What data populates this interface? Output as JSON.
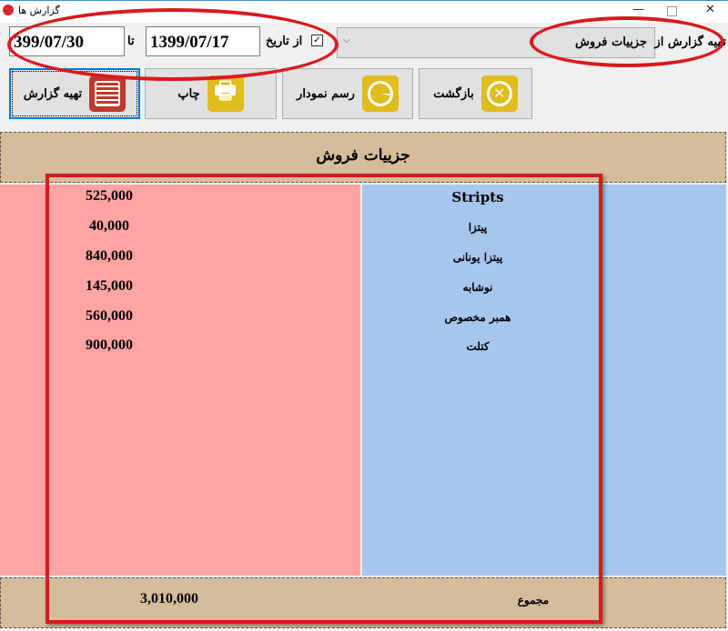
{
  "window": {
    "title": "گزارش ها",
    "controls": [
      "minimize",
      "maximize",
      "close"
    ]
  },
  "filter": {
    "to_date": "399/07/30",
    "to_label": "تا",
    "from_date": "1399/07/17",
    "from_label": "از تاریخ",
    "from_checked": true,
    "report_type_label": "تهیه گزارش از",
    "report_type_value": "جزییات فروش"
  },
  "toolbar": {
    "generate": "تهیه گزارش",
    "print": "چاپ",
    "chart": "رسم نمودار",
    "back": "بازگشت"
  },
  "report": {
    "title": "جزییات فروش",
    "rows": [
      {
        "name": "Stripts",
        "amount": "525,000"
      },
      {
        "name": "پیتزا",
        "amount": "40,000"
      },
      {
        "name": "پیتزا یونانی",
        "amount": "840,000"
      },
      {
        "name": "نوشابه",
        "amount": "145,000"
      },
      {
        "name": "همبر مخصوص",
        "amount": "560,000"
      },
      {
        "name": "کتلت",
        "amount": "900,000"
      }
    ],
    "total_label": "مجموع",
    "total": "3,010,000"
  },
  "colors": {
    "amount_column": "#ffa3a3",
    "name_column": "#a6c6ee",
    "band": "#d5bc9a",
    "annotation": "#d9191e",
    "accent": "#e0bc1e"
  }
}
